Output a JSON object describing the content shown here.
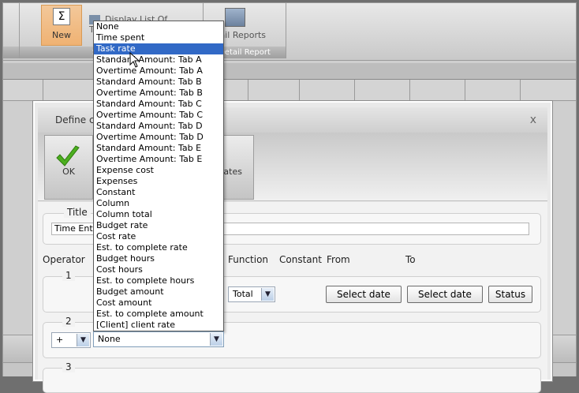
{
  "ribbon": {
    "new_label": "New",
    "display_list_label": "Display List Of Templates",
    "detail_reports_label": "Detail Reports",
    "group_summary_caption": "Summary",
    "group_detail_caption": "Detail Report"
  },
  "dialog": {
    "title": "Define column",
    "close_symbol": "x",
    "ok_label": "OK",
    "templates_label": "Templates",
    "title_legend": "Title",
    "title_value": "Time Entry",
    "headers": {
      "operator": "Operator",
      "function": "Function",
      "constant": "Constant",
      "from": "From",
      "to": "To"
    },
    "rows": [
      {
        "number": "1",
        "function_value": "Total",
        "select_date_1": "Select date",
        "select_date_2": "Select date",
        "status": "Status"
      },
      {
        "number": "2",
        "operator_value": "+",
        "type_value": "None"
      },
      {
        "number": "3"
      }
    ]
  },
  "dropdown": {
    "selected_index": 2,
    "items": [
      "None",
      "Time spent",
      "Task rate",
      "Standard Amount: Tab A",
      "Overtime Amount: Tab A",
      "Standard Amount: Tab B",
      "Overtime Amount: Tab B",
      "Standard Amount: Tab C",
      "Overtime Amount: Tab C",
      "Standard Amount: Tab D",
      "Overtime Amount: Tab D",
      "Standard Amount: Tab E",
      "Overtime Amount: Tab E",
      "Expense cost",
      "Expenses",
      "Constant",
      "Column",
      "Column total",
      "Budget rate",
      "Cost rate",
      "Est. to complete rate",
      "Budget hours",
      "Cost hours",
      "Est. to complete hours",
      "Budget amount",
      "Cost amount",
      "Est. to complete amount",
      "[Client] client rate"
    ]
  },
  "colors": {
    "selection": "#3169c6",
    "ok_check": "#4caf1f",
    "new_button": "#efb273"
  }
}
